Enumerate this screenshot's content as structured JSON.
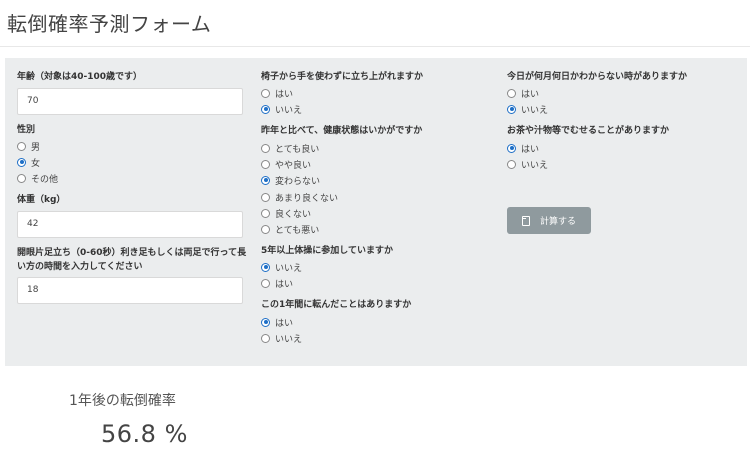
{
  "page": {
    "title": "転倒確率予測フォーム"
  },
  "form": {
    "age": {
      "label": "年齢（対象は40-100歳です）",
      "value": "70"
    },
    "sex": {
      "label": "性別",
      "options": [
        "男",
        "女",
        "その他"
      ],
      "selected": "女"
    },
    "weight": {
      "label": "体重（kg）",
      "value": "42"
    },
    "single_leg": {
      "label": "開眼片足立ち（0-60秒）利き足もしくは両足で行って長い方の時間を入力してください",
      "value": "18"
    },
    "chair_stand": {
      "label": "椅子から手を使わずに立ち上がれますか",
      "options": [
        "はい",
        "いいえ"
      ],
      "selected": "いいえ"
    },
    "health": {
      "label": "昨年と比べて、健康状態はいかがですか",
      "options": [
        "とても良い",
        "やや良い",
        "変わらない",
        "あまり良くない",
        "良くない",
        "とても悪い"
      ],
      "selected": "変わらない"
    },
    "exercise": {
      "label": "5年以上体操に参加していますか",
      "options": [
        "いいえ",
        "はい"
      ],
      "selected": "いいえ"
    },
    "fall": {
      "label": "この1年間に転んだことはありますか",
      "options": [
        "はい",
        "いいえ"
      ],
      "selected": "はい"
    },
    "date_confusion": {
      "label": "今日が何月何日かわからない時がありますか",
      "options": [
        "はい",
        "いいえ"
      ],
      "selected": "いいえ"
    },
    "choking": {
      "label": "お茶や汁物等でむせることがありますか",
      "options": [
        "はい",
        "いいえ"
      ],
      "selected": "はい"
    },
    "calculate_button": {
      "label": "計算する",
      "icon": "calculator-icon"
    }
  },
  "result": {
    "title": "1年後の転倒確率",
    "value": "56.8 %"
  }
}
